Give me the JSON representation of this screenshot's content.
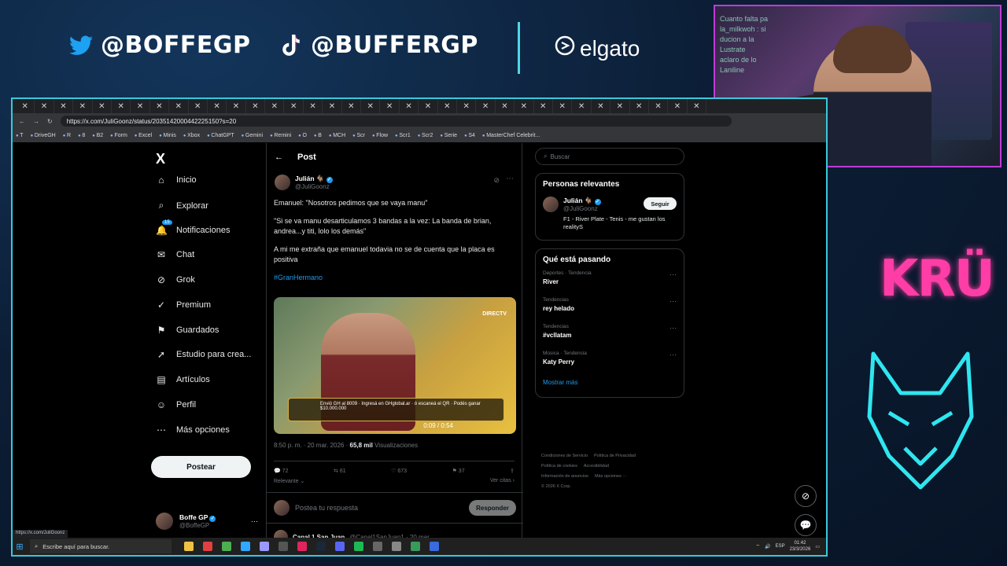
{
  "overlay": {
    "twitter_handle": "@BOFFEGP",
    "tiktok_handle": "@BUFFERGP",
    "sponsor": "elgato",
    "team_logo": "KRÜ",
    "cam_chat": [
      "Cuanto falta pa",
      "la_milkwoh : si",
      "ducion a la",
      "Lustrate",
      "aclaro de lo",
      "Laniline"
    ]
  },
  "browser": {
    "tab_count": 36,
    "url": "https://x.com/JuliGoonz/status/2035142000442225150?s=20",
    "bookmarks": [
      "T",
      "DriveGH",
      "R",
      "8",
      "B2",
      "Form",
      "Excel",
      "Minis",
      "Xbox",
      "ChatGPT",
      "Gemini",
      "Remini",
      "O",
      "B",
      "MCH",
      "Scr",
      "Flow",
      "Scr1",
      "Scr2",
      "Serie",
      "S4",
      "MasterChef Celebrit..."
    ],
    "status_url": "https://x.com/JuliGoonz"
  },
  "nav": {
    "logo": "X",
    "items": [
      {
        "label": "Inicio",
        "icon": "⌂"
      },
      {
        "label": "Explorar",
        "icon": "⌕"
      },
      {
        "label": "Notificaciones",
        "icon": "🔔",
        "badge": "15"
      },
      {
        "label": "Chat",
        "icon": "✉"
      },
      {
        "label": "Grok",
        "icon": "⊘"
      },
      {
        "label": "Premium",
        "icon": "✓"
      },
      {
        "label": "Guardados",
        "icon": "⚑"
      },
      {
        "label": "Estudio para crea...",
        "icon": "➚"
      },
      {
        "label": "Artículos",
        "icon": "▤"
      },
      {
        "label": "Perfil",
        "icon": "☺"
      },
      {
        "label": "Más opciones",
        "icon": "⋯"
      }
    ],
    "post_button": "Postear",
    "account": {
      "name": "Boffe GP",
      "handle": "@BoffeGP"
    }
  },
  "post": {
    "header": "Post",
    "author_name": "Julián 🐐",
    "author_handle": "@JuliGoonz",
    "paragraphs": [
      "Emanuel: \"Nosotros pedimos que se vaya manu\"",
      "\"Si se va manu desarticulamos 3 bandas a la vez: La banda de brian, andrea...y titi, lolo los demás\"",
      "A mi me extraña que emanuel todavia no se de cuenta que la placa es positiva"
    ],
    "hashtag": "#GranHermano",
    "media": {
      "tv_logo": "DIRECTV",
      "banner": "Envió GH al 8009 · Ingresá en GHglobal.ar · ó escaneá el QR · Podés ganar $10.000.000",
      "time": "0:09 / 0:54"
    },
    "timestamp": "8:50 p. m. · 20 mar. 2026 ·",
    "views": "65,8 mil",
    "views_label": "Visualizaciones",
    "replies": "72",
    "reposts": "61",
    "likes": "673",
    "bookmarks": "37",
    "sort_label": "Relevante",
    "quotes_label": "Ver citas",
    "reply_placeholder": "Postea tu respuesta",
    "reply_button": "Responder",
    "next_author": "Canal 1 San Juan",
    "next_handle": "@Canal1SanJuan1 · 20 mar."
  },
  "right": {
    "search_placeholder": "Buscar",
    "relevant_title": "Personas relevantes",
    "person": {
      "name": "Julián 🐐",
      "handle": "@JuliGoonz",
      "follow": "Seguir",
      "bio": "F1 - River Plate - Tenis - me gustan los realityS"
    },
    "trends_title": "Qué está pasando",
    "trends": [
      {
        "category": "Deportes · Tendencia",
        "title": "River"
      },
      {
        "category": "Tendencias",
        "title": "rey helado"
      },
      {
        "category": "Tendencias",
        "title": "#vcllatam"
      },
      {
        "category": "Música · Tendencia",
        "title": "Katy Perry"
      }
    ],
    "show_more": "Mostrar más",
    "footer": [
      "Condiciones de Servicio",
      "Política de Privacidad",
      "Política de cookies",
      "Accesibilidad",
      "Información de anuncios",
      "Más opciones ···",
      "© 2026 X Corp."
    ]
  },
  "taskbar": {
    "search": "Escribe aquí para buscar.",
    "lang": "ESP",
    "time": "01:42",
    "date": "23/3/2026"
  }
}
